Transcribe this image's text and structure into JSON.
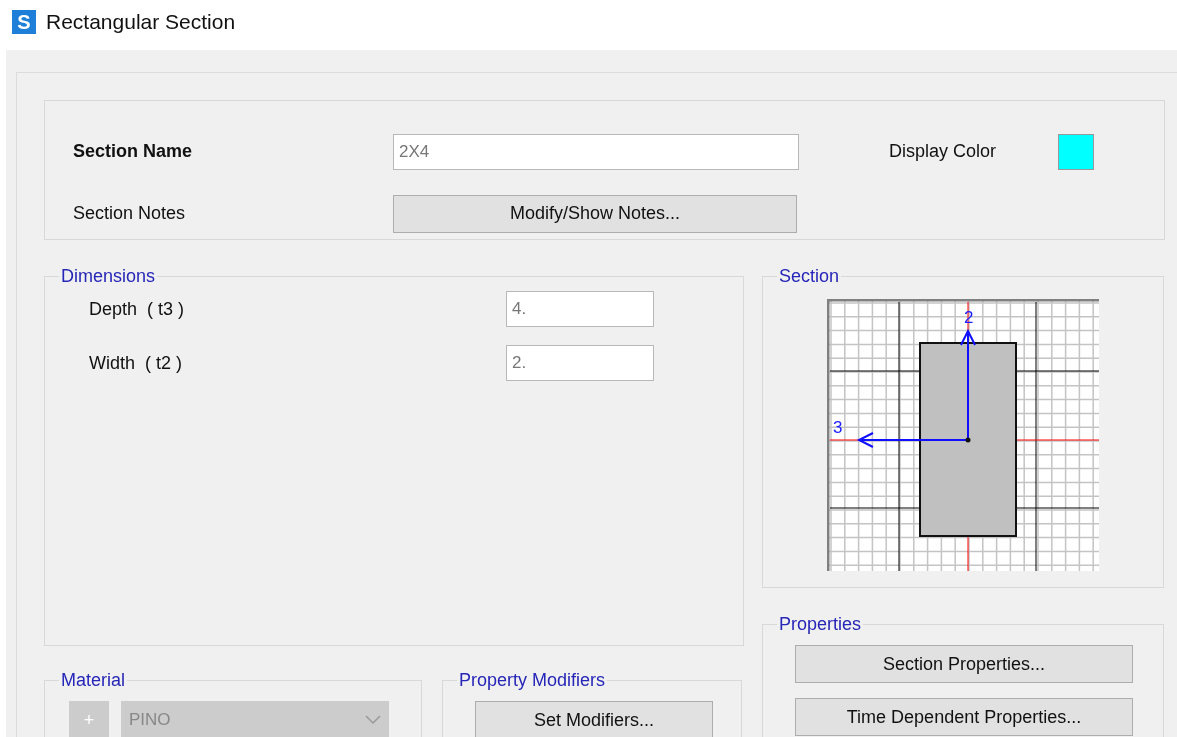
{
  "window": {
    "title": "Rectangular Section",
    "icon_letter": "S"
  },
  "section_name": {
    "label": "Section Name",
    "value": "2X4"
  },
  "display_color": {
    "label": "Display Color",
    "color": "#00ffff"
  },
  "section_notes": {
    "label": "Section Notes",
    "button": "Modify/Show Notes..."
  },
  "dimensions": {
    "title": "Dimensions",
    "fields": [
      {
        "label": "Depth  ( t3 )",
        "value": "4."
      },
      {
        "label": "Width  ( t2 )",
        "value": "2."
      }
    ]
  },
  "section": {
    "title": "Section",
    "axis_vertical": "2",
    "axis_horizontal": "3"
  },
  "material": {
    "title": "Material",
    "add_button": "+",
    "value": "PINO",
    "disabled": true
  },
  "property_modifiers": {
    "title": "Property Modifiers",
    "button": "Set Modifiers..."
  },
  "properties": {
    "title": "Properties",
    "buttons": [
      "Section Properties...",
      "Time Dependent Properties..."
    ]
  }
}
